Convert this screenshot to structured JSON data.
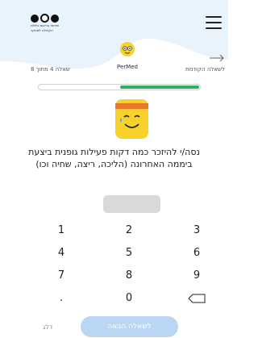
{
  "header": {
    "logo_icon": "org-logo-icon",
    "logo_text_line1": "שירותי בריאות כללית",
    "logo_text_line2": "הקהילה למחקר",
    "menu_icon": "hamburger-menu-icon",
    "badge_label": "PerMed",
    "badge_icon": "permed-face-icon",
    "wave_color": "#e9f3fb"
  },
  "navigation": {
    "question_counter": "שאלה 4 מתוך 8",
    "previous_label": "לשאלה הקודמת",
    "previous_icon": "arrow-right-icon"
  },
  "progress": {
    "fraction": 0.5,
    "fill_color": "#2db15a"
  },
  "question": {
    "emoji_icon": "sweating-smile-emoji-icon",
    "text": "נסה/י להיזכר כמה דקות פעילות גופנית ביצעת ביממה האחרונה (הליכה, ריצה, שחיה וכו)"
  },
  "answer": {
    "value": ""
  },
  "keypad": {
    "keys": [
      "1",
      "2",
      "3",
      "4",
      "5",
      "6",
      "7",
      "8",
      "9",
      ".",
      "0",
      ""
    ],
    "backspace_icon": "backspace-icon"
  },
  "footer": {
    "skip_label": "דלג",
    "next_label": "לשאלה הבאה",
    "next_color": "#b9d6f4"
  }
}
